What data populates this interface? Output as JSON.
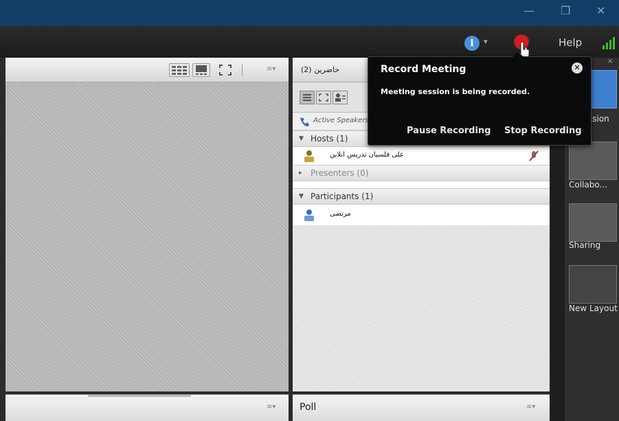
{
  "menubar": {
    "help_label": "Help",
    "info_caret": "▾"
  },
  "attendee_pod": {
    "title": "حاضرين",
    "count": "(2)",
    "active_speakers": "Active Speakers",
    "groups": {
      "hosts": {
        "label": "Hosts (1)",
        "expanded": true
      },
      "presenters": {
        "label": "Presenters (0)",
        "expanded": false
      },
      "participants": {
        "label": "Participants (1)",
        "expanded": true
      }
    },
    "host_name": "علی فلسیان تدریس انلاین",
    "participant_name": "مرتضی"
  },
  "poll_pod": {
    "title": "Poll"
  },
  "record_popup": {
    "title": "Record Meeting",
    "message": "Meeting session is being recorded.",
    "pause_label": "Pause Recording",
    "stop_label": "Stop Recording"
  },
  "layouts_panel": {
    "items": [
      {
        "label": "ssion"
      },
      {
        "label": "Collabo..."
      },
      {
        "label": "Sharing"
      },
      {
        "label": "New Layout"
      }
    ]
  },
  "colors": {
    "titlebar": "#123d67",
    "record_red": "#d81b1b",
    "signal_green": "#3dbb2a",
    "popup_bg": "#0b0b0b"
  }
}
